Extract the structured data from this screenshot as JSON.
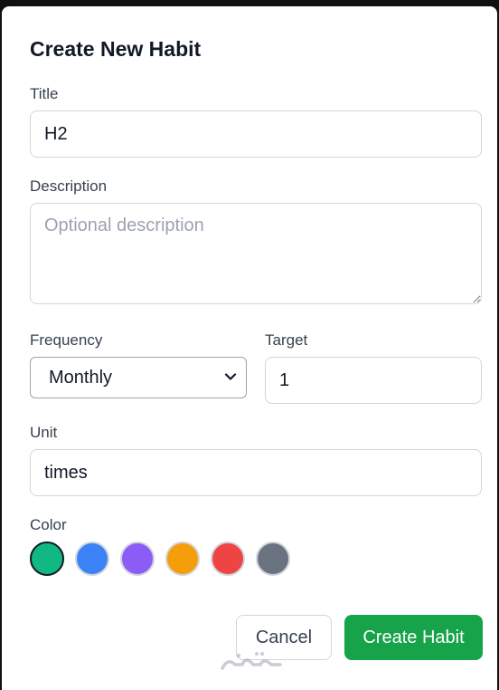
{
  "dialog": {
    "heading": "Create New Habit"
  },
  "form": {
    "title_label": "Title",
    "title_value": "H2",
    "description_label": "Description",
    "description_placeholder": "Optional description",
    "frequency_label": "Frequency",
    "frequency_value": "Monthly",
    "target_label": "Target",
    "target_value": "1",
    "unit_label": "Unit",
    "unit_value": "times",
    "color_label": "Color",
    "colors": [
      {
        "name": "green",
        "hex": "#10b981",
        "selected": true
      },
      {
        "name": "blue",
        "hex": "#3b82f6",
        "selected": false
      },
      {
        "name": "purple",
        "hex": "#8b5cf6",
        "selected": false
      },
      {
        "name": "orange",
        "hex": "#f59e0b",
        "selected": false
      },
      {
        "name": "red",
        "hex": "#ef4444",
        "selected": false
      },
      {
        "name": "gray",
        "hex": "#6b7280",
        "selected": false
      }
    ]
  },
  "actions": {
    "cancel_label": "Cancel",
    "create_label": "Create Habit"
  },
  "theme": {
    "primary": "#16a34a",
    "border": "#d1d5db",
    "text": "#111827"
  },
  "watermark": {
    "text": "mostaql.com"
  }
}
